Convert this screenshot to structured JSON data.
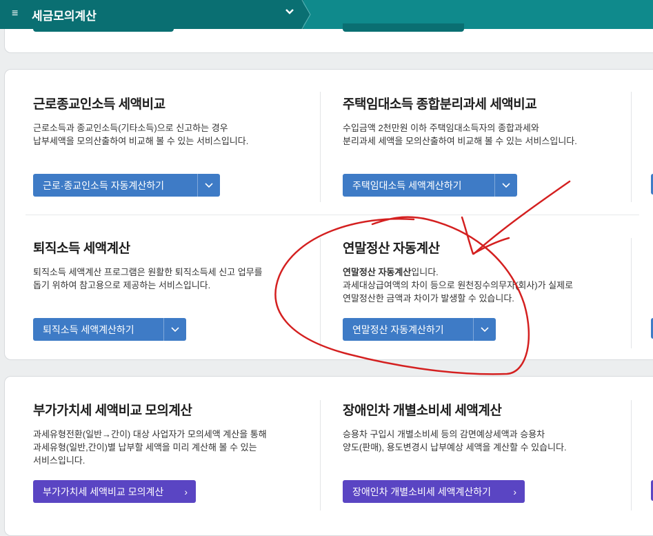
{
  "header": {
    "menu_icon": "≡",
    "title": "세금모의계산",
    "chevron": "⌄"
  },
  "items": [
    {
      "title": "근로종교인소득 세액비교",
      "desc": "근로소득과 종교인소득(기타소득)으로 신고하는 경우\n납부세액을 모의산출하여 비교해 볼 수 있는 서비스입니다.",
      "button": "근로·종교인소득 자동계산하기"
    },
    {
      "title": "주택임대소득 종합분리과세 세액비교",
      "desc": "수입금액 2천만원 이하 주택임대소득자의 종합과세와\n분리과세 세액을 모의산출하여 비교해 볼 수 있는 서비스입니다.",
      "button": "주택임대소득 세액계산하기"
    },
    {
      "title": "퇴직소득 세액계산",
      "desc": "퇴직소득 세액계산 프로그램은 원활한 퇴직소득세 신고 업무를\n돕기 위하여 참고용으로 제공하는 서비스입니다.",
      "button": "퇴직소득 세액계산하기"
    },
    {
      "title": "연말정산 자동계산",
      "desc_bold": "연말정산 자동계산",
      "desc_rest": "입니다.",
      "desc": "과세대상급여액의 차이 등으로 원천징수의무자(회사)가 실제로\n연말정산한 금액과 차이가 발생할 수 있습니다.",
      "button": "연말정산 자동계산하기"
    },
    {
      "title": "부가가치세 세액비교 모의계산",
      "desc": "과세유형전환(일반→간이) 대상 사업자가 모의세액 계산을 통해\n과세유형(일반,간이)별 납부할 세액을 미리 계산해 볼 수 있는\n서비스입니다.",
      "button": "부가가치세 세액비교 모의계산"
    },
    {
      "title": "장애인차 개별소비세 세액계산",
      "desc": "승용차 구입시 개별소비세 등의 감면예상세액과 승용차\n양도(판매), 용도변경시 납부예상 세액을 계산할 수 있습니다.",
      "button": "장애인차 개별소비세 세액계산하기"
    }
  ],
  "icons": {
    "dropdown": "⌵",
    "arrow": "›"
  },
  "colors": {
    "header": "#0f8a8c",
    "header_dark": "#0a6f72",
    "button_blue": "#3e7bc6",
    "button_purple": "#5a45c3",
    "annotation": "#d42020"
  }
}
